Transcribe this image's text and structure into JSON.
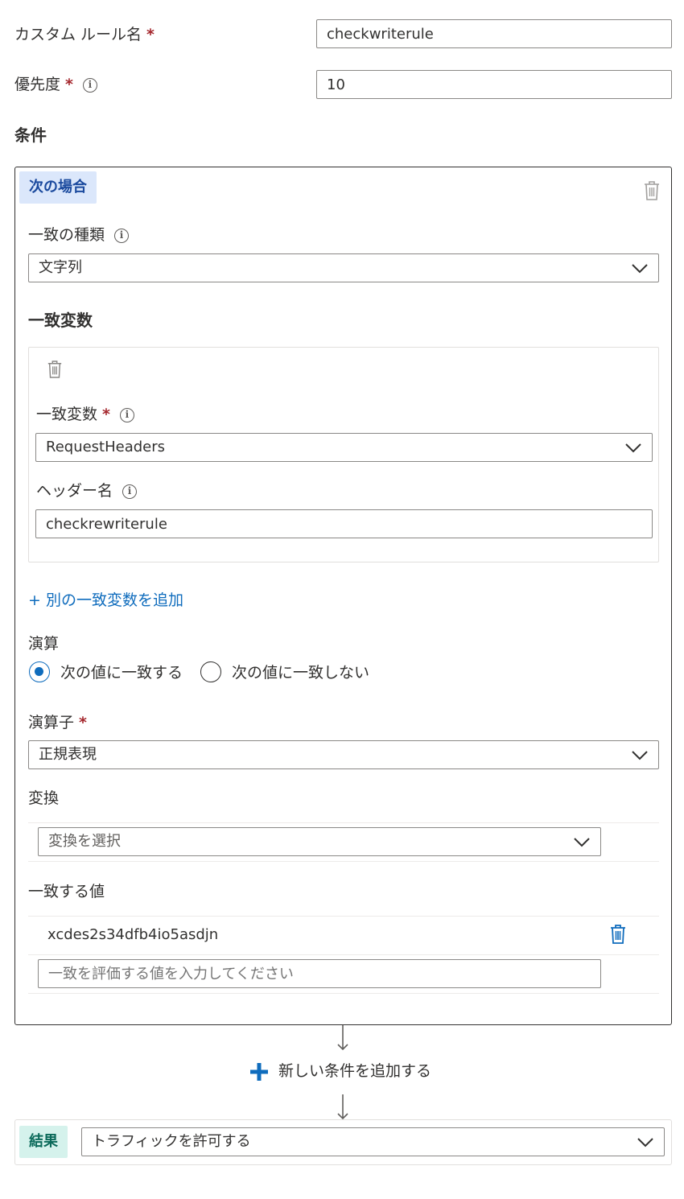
{
  "rule_name": {
    "label": "カスタム ルール名",
    "required_mark": "*",
    "value": "checkwriterule"
  },
  "priority": {
    "label": "優先度",
    "required_mark": "*",
    "value": "10"
  },
  "conditions_title": "条件",
  "condition": {
    "badge": "次の場合",
    "match_type": {
      "label": "一致の種類",
      "value": "文字列"
    },
    "match_variables_title": "一致変数",
    "match_variable": {
      "label": "一致変数",
      "required_mark": "*",
      "value": "RequestHeaders",
      "header_label": "ヘッダー名",
      "header_value": "checkrewriterule"
    },
    "add_variable_link": "+ 別の一致変数を追加",
    "operation": {
      "label": "演算",
      "option_match": "次の値に一致する",
      "option_not_match": "次の値に一致しない",
      "selected": "match"
    },
    "operator": {
      "label": "演算子",
      "required_mark": "*",
      "value": "正規表現"
    },
    "transform": {
      "label": "変換",
      "placeholder": "変換を選択"
    },
    "match_values": {
      "label": "一致する値",
      "items": [
        "xcdes2s34dfb4io5asdjn"
      ],
      "placeholder": "一致を評価する値を入力してください"
    }
  },
  "add_condition": "新しい条件を追加する",
  "result": {
    "badge": "結果",
    "value": "トラフィックを許可する"
  },
  "colors": {
    "accent": "#0f6cbd",
    "required": "#a4262c",
    "if_badge_bg": "#dbe7fb",
    "result_badge_bg": "#d5f2ec"
  },
  "icons": {
    "info": "info-icon",
    "trash": "trash-icon",
    "chevron": "chevron-down-icon",
    "plus": "plus-icon",
    "arrow": "arrow-down-icon"
  }
}
